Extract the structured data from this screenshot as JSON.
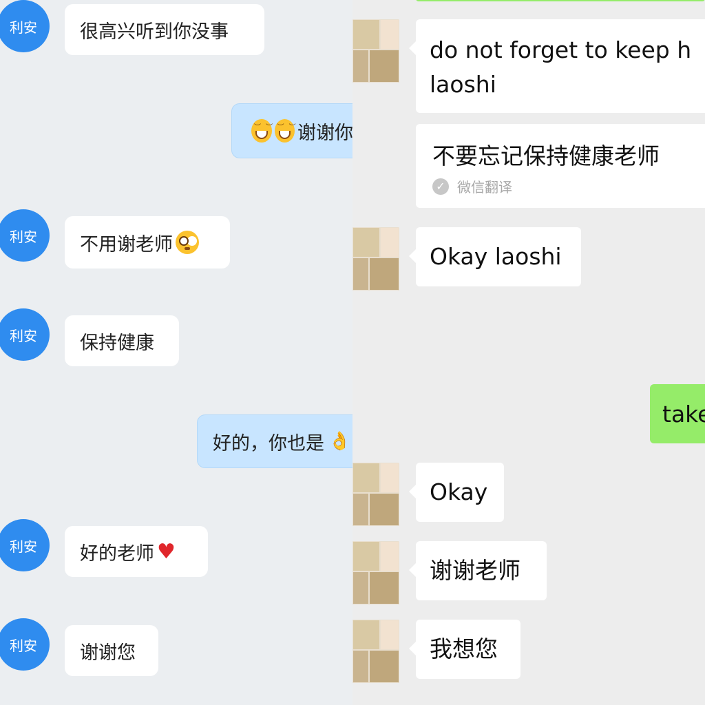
{
  "left_chat": {
    "contact_avatar_label": "利安",
    "messages": [
      {
        "side": "received",
        "text": "很高兴听到你没事"
      },
      {
        "side": "sent",
        "text": "谢谢你",
        "emoji": [
          "grin-icon",
          "grin-icon"
        ]
      },
      {
        "side": "received",
        "text": "不用谢老师",
        "emoji": [
          "flushed-face-icon"
        ]
      },
      {
        "side": "received",
        "text": "保持健康"
      },
      {
        "side": "sent",
        "text": "好的，你也是",
        "emoji": [
          "ok-hand-icon"
        ]
      },
      {
        "side": "received",
        "text": "好的老师",
        "emoji": [
          "red-heart-icon"
        ]
      },
      {
        "side": "received",
        "text": "谢谢您"
      }
    ]
  },
  "right_chat": {
    "messages": [
      {
        "side": "received",
        "text_lines": [
          "do not forget to keep h",
          "laoshi"
        ]
      },
      {
        "side": "received",
        "text": "不要忘记保持健康老师",
        "translation_label": "微信翻译"
      },
      {
        "side": "received",
        "text": "Okay laoshi"
      },
      {
        "side": "sent",
        "text": "take"
      },
      {
        "side": "received",
        "text": "Okay"
      },
      {
        "side": "received",
        "text": "谢谢老师"
      },
      {
        "side": "received",
        "text": "我想您"
      }
    ],
    "colors": {
      "sent_bubble": "#95ec69",
      "received_bubble": "#ffffff",
      "background": "#ededed"
    }
  },
  "colors": {
    "left_avatar": "#2f8cef",
    "left_sent_bubble": "#c8e5ff",
    "left_background": "#ebeef1"
  }
}
